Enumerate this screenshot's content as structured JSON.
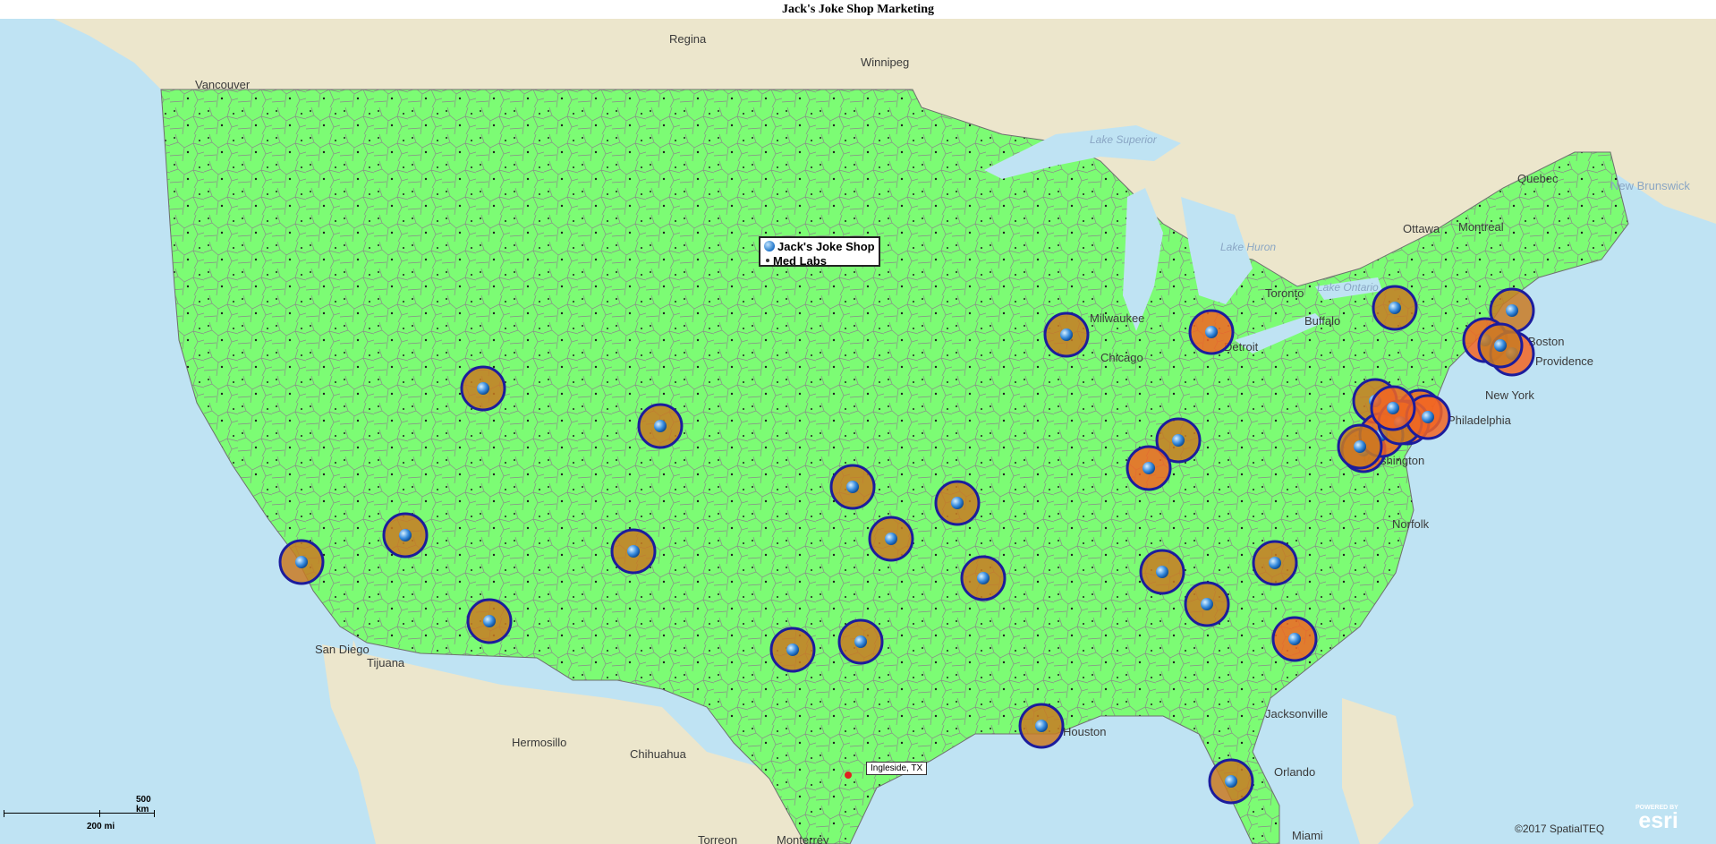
{
  "title": "Jack's Joke Shop Marketing",
  "legend": {
    "items": [
      {
        "label": "Jack's Joke Shop",
        "icon": "blue-sphere-icon"
      },
      {
        "label": "Med Labs",
        "icon": "black-dot-icon"
      }
    ]
  },
  "callout": {
    "label": "Ingleside, TX"
  },
  "scale_bar": {
    "top_label": "500 km",
    "bottom_label": "200 mi"
  },
  "copyright": "©2017 SpatialTEQ",
  "esri": {
    "powered_by": "POWERED BY",
    "brand": "esri"
  },
  "colors": {
    "ocean": "#bfe3f3",
    "land": "#ece6cc",
    "territory_fill": "#7cfc74",
    "territory_border": "#808080",
    "ring": "#1c1c9c",
    "ring_fill": "#c97a22",
    "hot_fill": "#f26522"
  },
  "place_labels": [
    "Regina",
    "Winnipeg",
    "Vancouver",
    "Ottawa",
    "Montreal",
    "Quebec",
    "New Brunswick",
    "Toronto",
    "Buffalo",
    "Detroit",
    "Milwaukee",
    "Chicago",
    "Boston",
    "Providence",
    "New York",
    "Philadelphia",
    "Washington",
    "Norfolk",
    "Jacksonville",
    "Orlando",
    "Miami",
    "Houston",
    "San Diego",
    "Tijuana",
    "Hermosillo",
    "Chihuahua",
    "Torreon",
    "Monterrey",
    "Lake Superior",
    "Lake Huron",
    "Lake Ontario"
  ],
  "shops": [
    {
      "id": "shop-1"
    },
    {
      "id": "shop-2"
    },
    {
      "id": "shop-3"
    },
    {
      "id": "shop-4"
    },
    {
      "id": "shop-5"
    },
    {
      "id": "shop-6"
    },
    {
      "id": "shop-7"
    },
    {
      "id": "shop-8"
    },
    {
      "id": "shop-9"
    },
    {
      "id": "shop-10"
    },
    {
      "id": "shop-11"
    },
    {
      "id": "shop-12"
    },
    {
      "id": "shop-13"
    },
    {
      "id": "shop-14"
    },
    {
      "id": "shop-15"
    },
    {
      "id": "shop-16"
    },
    {
      "id": "shop-17"
    },
    {
      "id": "shop-18"
    },
    {
      "id": "shop-19"
    },
    {
      "id": "shop-20"
    },
    {
      "id": "shop-21"
    },
    {
      "id": "shop-22"
    },
    {
      "id": "shop-23"
    },
    {
      "id": "shop-24"
    },
    {
      "id": "shop-25"
    },
    {
      "id": "shop-26"
    },
    {
      "id": "shop-27"
    },
    {
      "id": "shop-28"
    },
    {
      "id": "shop-29"
    },
    {
      "id": "shop-30"
    },
    {
      "id": "shop-31"
    },
    {
      "id": "shop-32"
    },
    {
      "id": "shop-33"
    },
    {
      "id": "shop-34"
    },
    {
      "id": "shop-35"
    },
    {
      "id": "shop-36"
    }
  ]
}
